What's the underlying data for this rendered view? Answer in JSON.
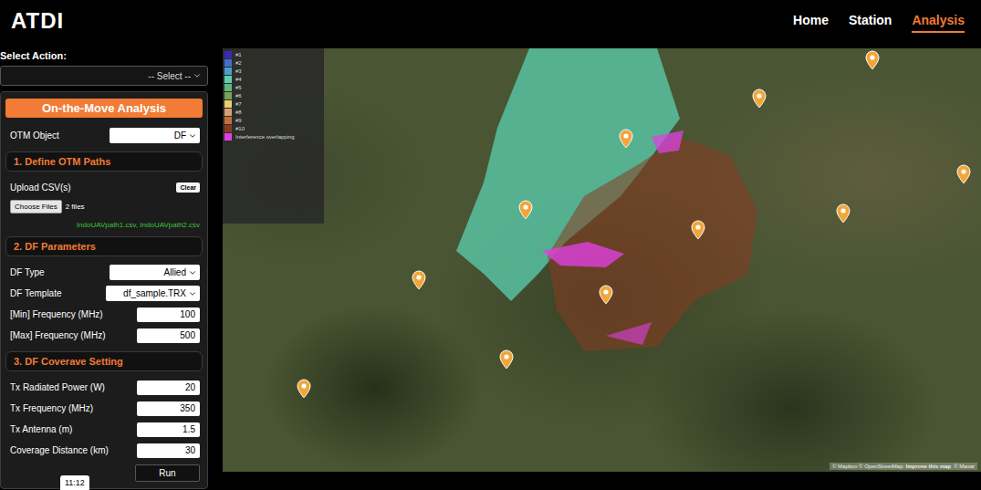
{
  "header": {
    "logo": "ATDI",
    "nav": [
      {
        "label": "Home",
        "selected": false
      },
      {
        "label": "Station",
        "selected": false
      },
      {
        "label": "Analysis",
        "selected": true
      }
    ]
  },
  "sidebar": {
    "action_label": "Select Action:",
    "action_select": "-- Select --",
    "panel_button": "On-the-Move Analysis",
    "otm_object": {
      "label": "OTM Object",
      "value": "DF"
    },
    "paths": {
      "title": "1. Define OTM Paths",
      "upload_label": "Upload CSV(s)",
      "clear": "Clear",
      "choose": "Choose Files",
      "count": "2 files",
      "files": "IndoUAVpath1.csv, IndoUAVpath2.csv"
    },
    "df_params": {
      "title": "2. DF Parameters",
      "fields": [
        {
          "label": "DF Type",
          "value": "Allied",
          "kind": "select"
        },
        {
          "label": "DF Template",
          "value": "df_sample.TRX",
          "kind": "select"
        },
        {
          "label": "[Min] Frequency (MHz)",
          "value": "100",
          "kind": "input"
        },
        {
          "label": "[Max] Frequency (MHz)",
          "value": "500",
          "kind": "input"
        }
      ]
    },
    "coverage": {
      "title": "3. DF Coverave Setting",
      "fields": [
        {
          "label": "Tx Radiated Power (W)",
          "value": "20",
          "kind": "input"
        },
        {
          "label": "Tx Frequency (MHz)",
          "value": "350",
          "kind": "input"
        },
        {
          "label": "Tx Antenna (m)",
          "value": "1.5",
          "kind": "input"
        },
        {
          "label": "Coverage Distance (km)",
          "value": "30",
          "kind": "input"
        }
      ],
      "run": "Run"
    }
  },
  "video_time": "11:12",
  "map": {
    "legend": [
      {
        "label": "#1",
        "color": "#3a2bb5"
      },
      {
        "label": "#2",
        "color": "#3f6fd1"
      },
      {
        "label": "#3",
        "color": "#4aa0c8"
      },
      {
        "label": "#4",
        "color": "#59d0b0"
      },
      {
        "label": "#5",
        "color": "#5fb87a"
      },
      {
        "label": "#6",
        "color": "#7aa05a"
      },
      {
        "label": "#7",
        "color": "#e8d070"
      },
      {
        "label": "#8",
        "color": "#d8a070"
      },
      {
        "label": "#9",
        "color": "#c07040"
      },
      {
        "label": "#10",
        "color": "#8a3a20"
      },
      {
        "label": "Interference overlapping",
        "color": "#e040e0"
      }
    ],
    "attribution": "© Mapbox © OpenStreetMap",
    "attribution_link": "Improve this map",
    "attribution_end": "© Maxar"
  }
}
